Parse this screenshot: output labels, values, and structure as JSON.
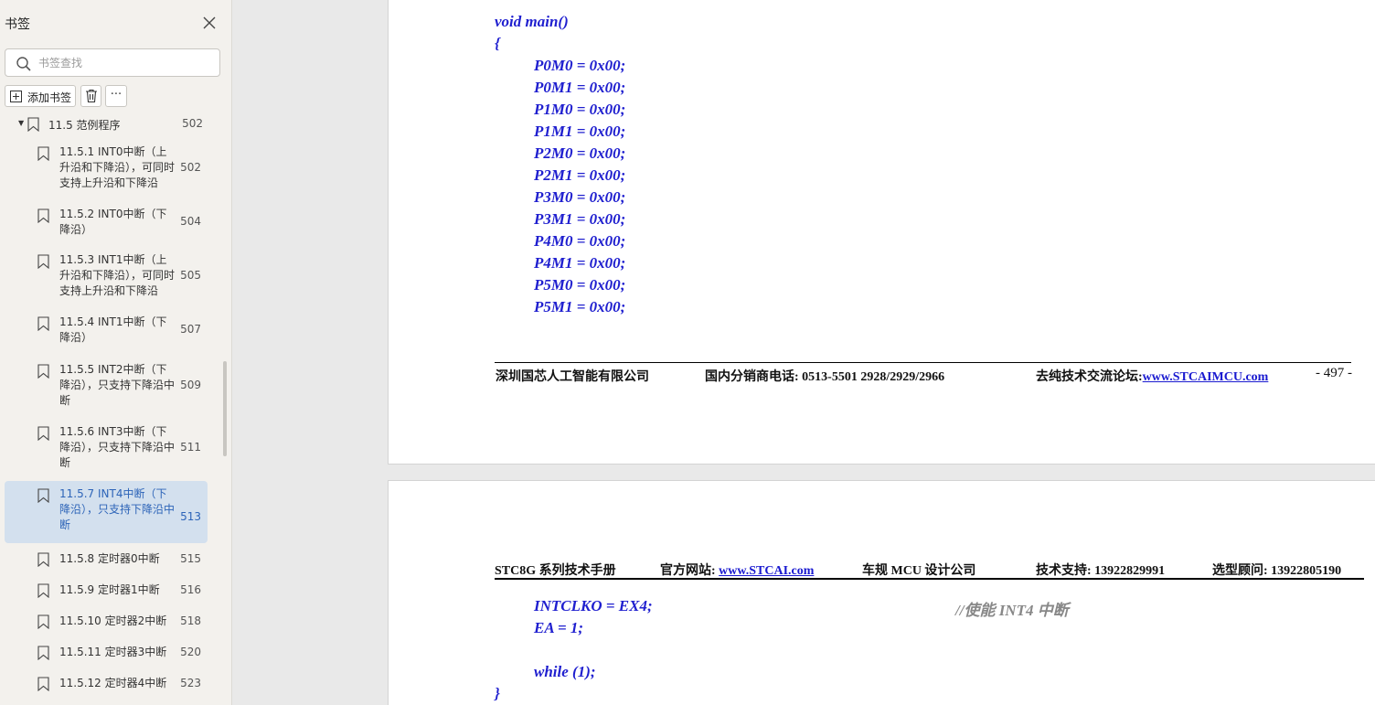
{
  "sidebar": {
    "title": "书签",
    "search_placeholder": "书签查找",
    "add_label": "添加书签",
    "more_label": "···",
    "parent": {
      "label": "11.5 范例程序",
      "page": "502"
    },
    "items": [
      {
        "label": "11.5.1 INT0中断（上升沿和下降沿），可同时支持上升沿和下降沿",
        "page": "502",
        "active": false
      },
      {
        "label": "11.5.2 INT0中断（下降沿）",
        "page": "504",
        "active": false
      },
      {
        "label": "11.5.3 INT1中断（上升沿和下降沿），可同时支持上升沿和下降沿",
        "page": "505",
        "active": false
      },
      {
        "label": "11.5.4 INT1中断（下降沿）",
        "page": "507",
        "active": false
      },
      {
        "label": "11.5.5 INT2中断（下降沿），只支持下降沿中断",
        "page": "509",
        "active": false
      },
      {
        "label": "11.5.6 INT3中断（下降沿），只支持下降沿中断",
        "page": "511",
        "active": false
      },
      {
        "label": "11.5.7 INT4中断（下降沿），只支持下降沿中断",
        "page": "513",
        "active": true
      },
      {
        "label": "11.5.8 定时器0中断",
        "page": "515",
        "active": false
      },
      {
        "label": "11.5.9 定时器1中断",
        "page": "516",
        "active": false
      },
      {
        "label": "11.5.10 定时器2中断",
        "page": "518",
        "active": false
      },
      {
        "label": "11.5.11 定时器3中断",
        "page": "520",
        "active": false
      },
      {
        "label": "11.5.12 定时器4中断",
        "page": "523",
        "active": false
      }
    ]
  },
  "page1": {
    "code": [
      "void main()",
      "{",
      "P0M0 = 0x00;",
      "P0M1 = 0x00;",
      "P1M0 = 0x00;",
      "P1M1 = 0x00;",
      "P2M0 = 0x00;",
      "P2M1 = 0x00;",
      "P3M0 = 0x00;",
      "P3M1 = 0x00;",
      "P4M0 = 0x00;",
      "P4M1 = 0x00;",
      "P5M0 = 0x00;",
      "P5M1 = 0x00;"
    ],
    "footer": {
      "company": "深圳国芯人工智能有限公司",
      "phone": "国内分销商电话: 0513-5501 2928/2929/2966",
      "forum_label": "去纯技术交流论坛:",
      "forum_link": "www.STCAIMCU.com",
      "page_number": "- 497 -"
    }
  },
  "page2": {
    "header": {
      "manual": "STC8G 系列技术手册",
      "site_label": "官方网站: ",
      "site_link": "www.STCAI.com",
      "slogan": "车规 MCU 设计公司",
      "support": "技术支持: 13922829991",
      "advisor": "选型顾问: 13922805190"
    },
    "code": [
      "INTCLKO = EX4;",
      "EA = 1;",
      "while (1);",
      "}"
    ],
    "comment": "//使能 INT4 中断"
  },
  "colors": {
    "code": "#1f1fcf",
    "link": "#1a1ad0",
    "active_bg": "#d3e0ee",
    "active_text": "#2d64b8"
  }
}
